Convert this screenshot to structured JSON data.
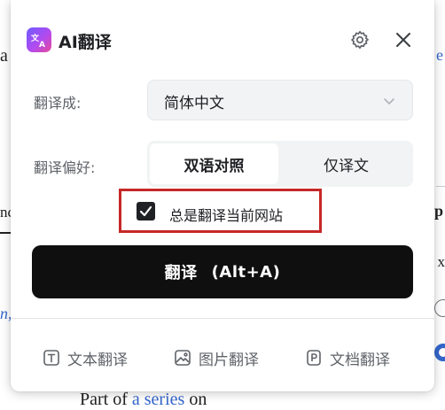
{
  "background_page": {
    "frag_left_1": "a",
    "frag_left_2": "nc",
    "frag_left_3": "n,",
    "frag_right_1": "e",
    "frag_right_2": "p",
    "frag_right_3": "x",
    "bottom_text_prefix": "Part of ",
    "bottom_text_link": "a series",
    "bottom_text_suffix": " on"
  },
  "panel": {
    "app_title": "AI翻译",
    "logo_icon": "translate-logo-icon",
    "settings_icon": "gear-icon",
    "close_icon": "close-icon"
  },
  "target_language": {
    "label": "翻译成:",
    "value": "简体中文"
  },
  "preference": {
    "label": "翻译偏好:",
    "options": [
      "双语对照",
      "仅译文"
    ],
    "selected": "双语对照"
  },
  "always_translate": {
    "label": "总是翻译当前网站",
    "checked": true
  },
  "translate_button": {
    "label": "翻译",
    "shortcut": "(Alt+A)"
  },
  "tools": [
    {
      "label": "文本翻译",
      "icon": "text-icon"
    },
    {
      "label": "图片翻译",
      "icon": "image-icon"
    },
    {
      "label": "文档翻译",
      "icon": "document-icon"
    }
  ],
  "colors": {
    "primary_button": "#0f0f0f",
    "highlight_border": "#c62828",
    "link": "#3366cc"
  }
}
